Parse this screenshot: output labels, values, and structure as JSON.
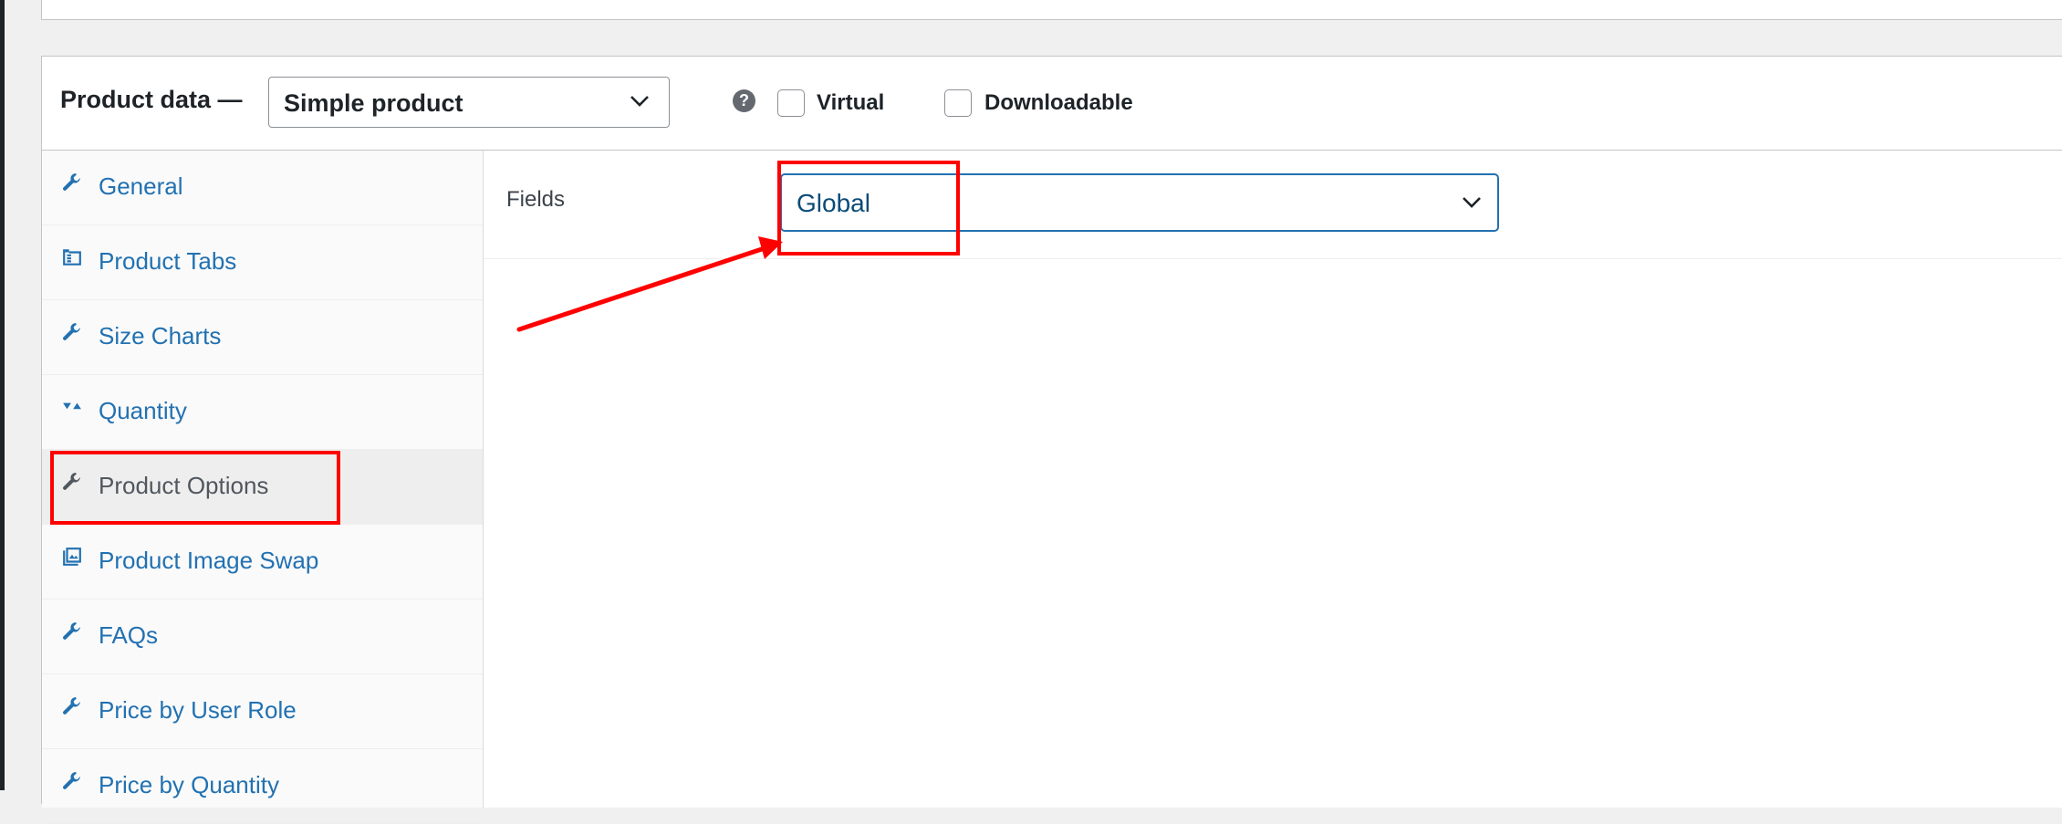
{
  "product_data": {
    "title": "Product data —",
    "product_type": {
      "selected": "Simple product"
    },
    "help_icon_glyph": "?",
    "checkboxes": [
      {
        "label": "Virtual",
        "checked": false
      },
      {
        "label": "Downloadable",
        "checked": false
      }
    ]
  },
  "tabs": [
    {
      "label": "General",
      "icon": "wrench-icon"
    },
    {
      "label": "Product Tabs",
      "icon": "tabs-icon"
    },
    {
      "label": "Size Charts",
      "icon": "wrench-icon"
    },
    {
      "label": "Quantity",
      "icon": "quantity-icon"
    },
    {
      "label": "Product Options",
      "icon": "wrench-icon",
      "active": true
    },
    {
      "label": "Product Image Swap",
      "icon": "image-swap-icon"
    },
    {
      "label": "FAQs",
      "icon": "wrench-icon"
    },
    {
      "label": "Price by User Role",
      "icon": "wrench-icon"
    },
    {
      "label": "Price by Quantity",
      "icon": "wrench-icon"
    }
  ],
  "panel": {
    "fields_label": "Fields",
    "fields_select": {
      "selected": "Global"
    }
  },
  "colors": {
    "link": "#2271b1",
    "annotation": "#ff0000",
    "focus_border": "#2271b1"
  }
}
